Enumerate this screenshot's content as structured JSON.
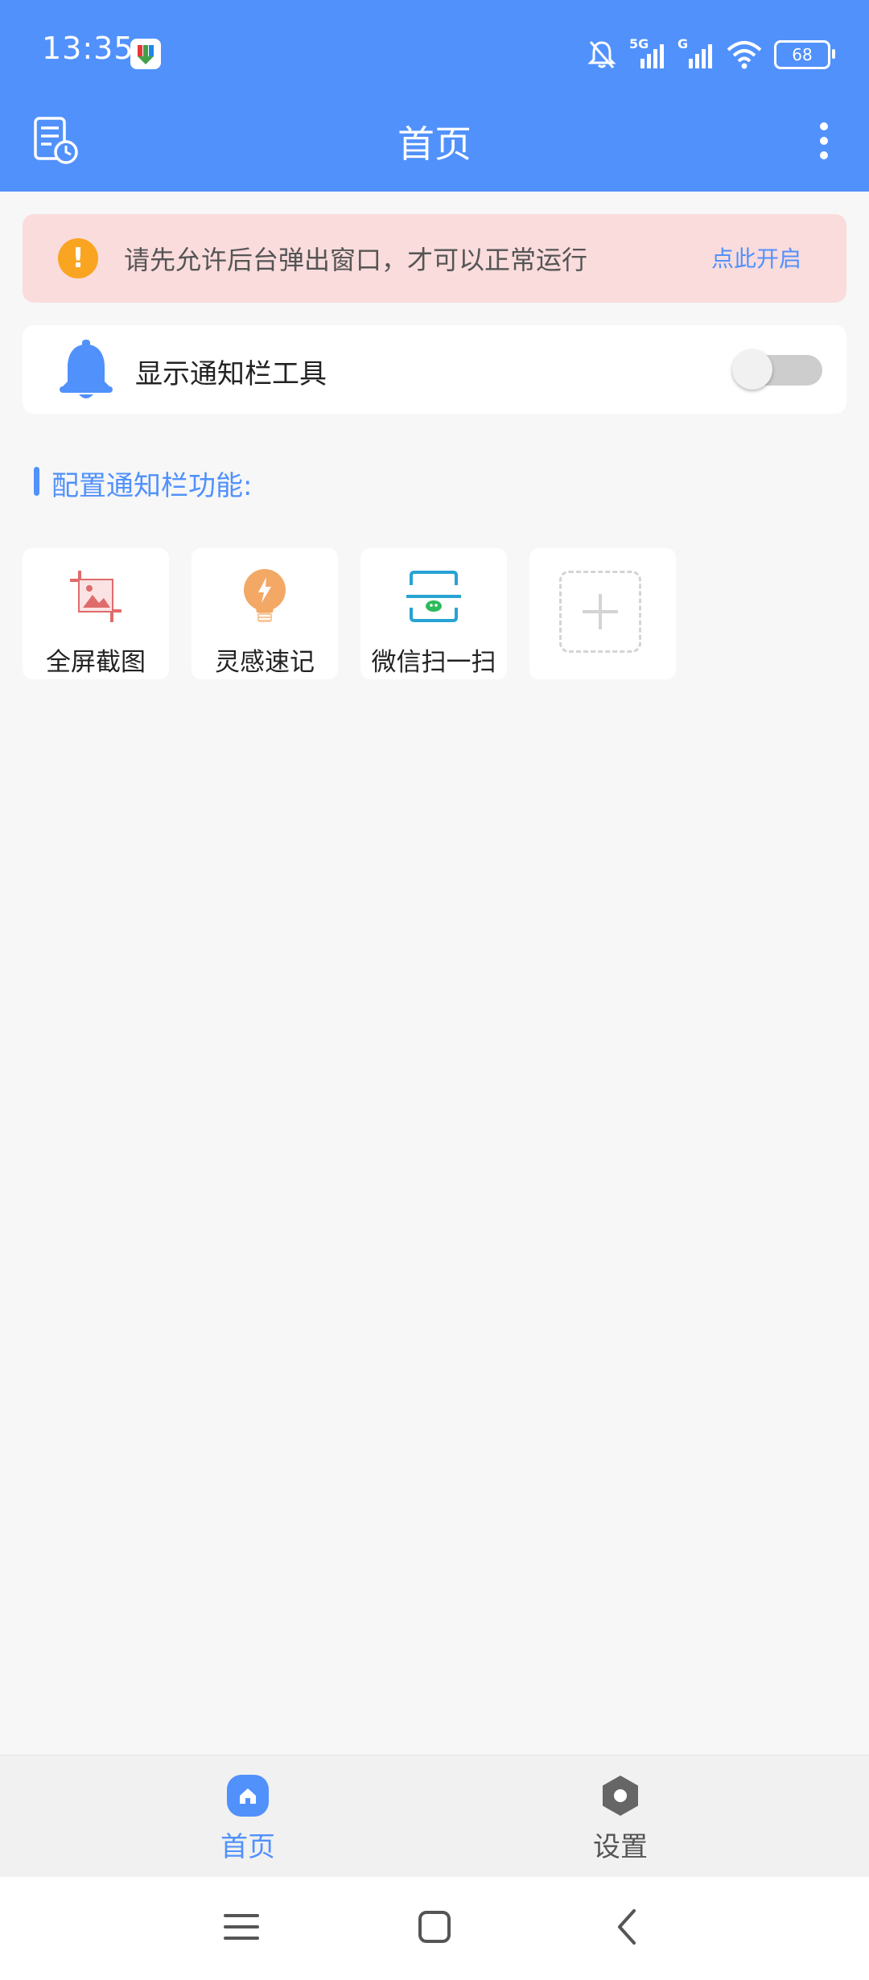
{
  "status_bar": {
    "time": "13:35",
    "network_1": "5G",
    "network_2": "G",
    "battery": "68"
  },
  "app_bar": {
    "title": "首页"
  },
  "banner": {
    "icon": "!",
    "message": "请先允许后台弹出窗口，才可以正常运行",
    "action": "点此开启"
  },
  "toggle_card": {
    "label": "显示通知栏工具",
    "enabled": false
  },
  "section": {
    "title": "配置通知栏功能:"
  },
  "tiles": [
    {
      "label": "全屏截图",
      "icon": "crop-image-icon"
    },
    {
      "label": "灵感速记",
      "icon": "lightbulb-icon"
    },
    {
      "label": "微信扫一扫",
      "icon": "scan-icon"
    },
    {
      "label": "",
      "icon": "add-icon"
    }
  ],
  "tab_bar": {
    "items": [
      {
        "label": "首页",
        "icon": "home-icon",
        "active": true
      },
      {
        "label": "设置",
        "icon": "settings-icon",
        "active": false
      }
    ]
  },
  "colors": {
    "brand": "#5191fc",
    "banner_bg": "#fadcdd",
    "warning": "#f9a521",
    "background": "#f7f7f7"
  }
}
